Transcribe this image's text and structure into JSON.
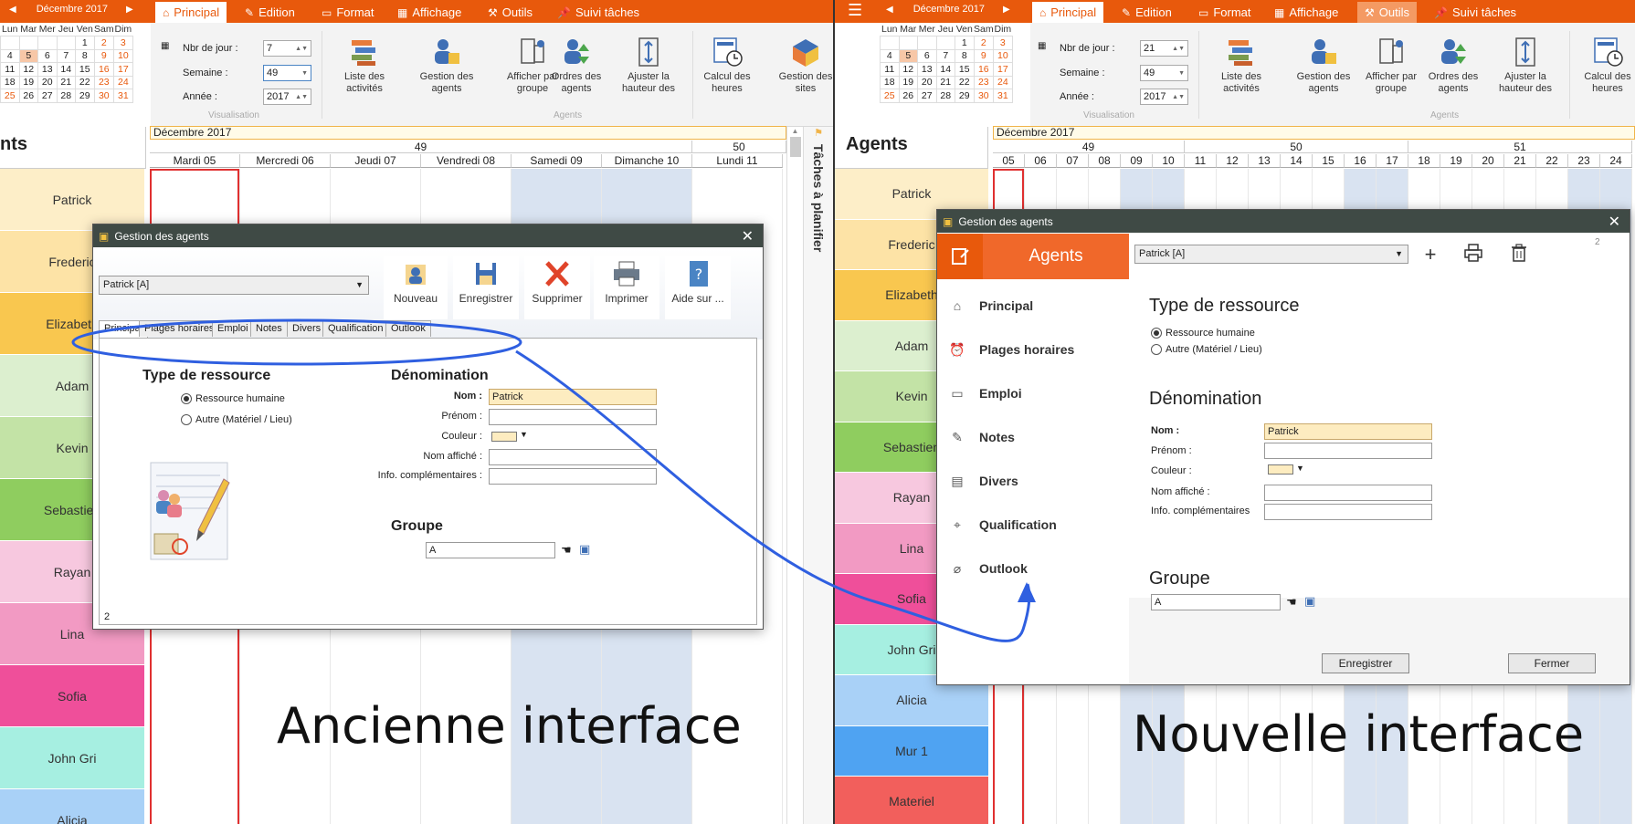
{
  "left": {
    "month_nav": "Décembre 2017",
    "tabs": [
      {
        "label": "Principal",
        "icon": "home-icon"
      },
      {
        "label": "Edition",
        "icon": "edit-icon"
      },
      {
        "label": "Format",
        "icon": "paint-roller-icon"
      },
      {
        "label": "Affichage",
        "icon": "grid-icon"
      },
      {
        "label": "Outils",
        "icon": "tools-icon"
      },
      {
        "label": "Suivi tâches",
        "icon": "pin-icon"
      }
    ],
    "fields": {
      "nbr_label": "Nbr de jour :",
      "nbr_value": "7",
      "semaine_label": "Semaine :",
      "semaine_value": "49",
      "annee_label": "Année :",
      "annee_value": "2017"
    },
    "ribbon_buttons": [
      {
        "label": "Liste des activités"
      },
      {
        "label": "Gestion des agents"
      },
      {
        "label": "Afficher par groupe"
      },
      {
        "label": "Ordres des agents"
      },
      {
        "label": "Ajuster la hauteur des"
      },
      {
        "label": "Calcul des heures"
      },
      {
        "label": "Gestion des sites"
      }
    ],
    "groups": {
      "visualisation": "Visualisation",
      "agents": "Agents"
    },
    "agents_title": "nts",
    "month_bar": "Décembre 2017",
    "weeks": [
      "49",
      "50"
    ],
    "days": [
      "Mardi 05",
      "Mercredi 06",
      "Jeudi 07",
      "Vendredi 08",
      "Samedi 09",
      "Dimanche 10",
      "Lundi 11"
    ],
    "agents": [
      "Patrick",
      "Frederic",
      "Elizabeth",
      "Adam",
      "Kevin",
      "Sebastien",
      "Rayan",
      "Lina",
      "Sofia",
      "John Gri",
      "Alicia"
    ],
    "side_label": "Tâches à planifier",
    "dialog": {
      "title": "Gestion des agents",
      "agent_select": "Patrick  [A]",
      "toolbar": [
        {
          "label": "Nouveau",
          "icon": "new-agent-icon"
        },
        {
          "label": "Enregistrer",
          "icon": "save-icon"
        },
        {
          "label": "Supprimer",
          "icon": "delete-icon"
        },
        {
          "label": "Imprimer",
          "icon": "printer-icon"
        },
        {
          "label": "Aide sur ...",
          "icon": "help-icon"
        }
      ],
      "tabs": [
        "Principal",
        "Plages horaires",
        "Emploi",
        "Notes",
        "Divers",
        "Qualification",
        "Outlook"
      ],
      "type_title": "Type de ressource",
      "radio_human": "Ressource humaine",
      "radio_other": "Autre (Matériel / Lieu)",
      "denom_title": "Dénomination",
      "nom_label": "Nom :",
      "nom_value": "Patrick",
      "prenom_label": "Prénom :",
      "couleur_label": "Couleur :",
      "affiche_label": "Nom affiché :",
      "info_label": "Info. complémentaires :",
      "groupe_title": "Groupe",
      "groupe_value": "A",
      "footer_num": "2"
    },
    "caption": "Ancienne interface"
  },
  "right": {
    "month_nav": "Décembre 2017",
    "tabs": [
      {
        "label": "Principal",
        "icon": "home-icon"
      },
      {
        "label": "Edition",
        "icon": "edit-icon"
      },
      {
        "label": "Format",
        "icon": "paint-roller-icon"
      },
      {
        "label": "Affichage",
        "icon": "grid-icon"
      },
      {
        "label": "Outils",
        "icon": "tools-icon"
      },
      {
        "label": "Suivi tâches",
        "icon": "pin-icon"
      }
    ],
    "fields": {
      "nbr_label": "Nbr de jour :",
      "nbr_value": "21",
      "semaine_label": "Semaine :",
      "semaine_value": "49",
      "annee_label": "Année :",
      "annee_value": "2017"
    },
    "ribbon_buttons": [
      {
        "label": "Liste des activités"
      },
      {
        "label": "Gestion des agents"
      },
      {
        "label": "Afficher par groupe"
      },
      {
        "label": "Ordres des agents"
      },
      {
        "label": "Ajuster la hauteur des"
      },
      {
        "label": "Calcul des heures"
      }
    ],
    "groups": {
      "visualisation": "Visualisation",
      "agents": "Agents"
    },
    "agents_title": "Agents",
    "month_bar": "Décembre 2017",
    "weeks": [
      "49",
      "50",
      "51"
    ],
    "days": [
      "05",
      "06",
      "07",
      "08",
      "09",
      "10",
      "11",
      "12",
      "13",
      "14",
      "15",
      "16",
      "17",
      "18",
      "19",
      "20",
      "21",
      "22",
      "23",
      "24"
    ],
    "agents": [
      "Patrick",
      "Frederic",
      "Elizabeth",
      "Adam",
      "Kevin",
      "Sebastien",
      "Rayan",
      "Lina",
      "Sofia",
      "John Gri",
      "Alicia",
      "Mur 1",
      "Materiel"
    ],
    "dialog": {
      "title": "Gestion des agents",
      "nav_title": "Agents",
      "agent_select": "Patrick  [A]",
      "nav": [
        {
          "label": "Principal",
          "icon": "home-icon"
        },
        {
          "label": "Plages horaires",
          "icon": "alarm-clock-icon"
        },
        {
          "label": "Emploi",
          "icon": "briefcase-icon"
        },
        {
          "label": "Notes",
          "icon": "pencil-icon"
        },
        {
          "label": "Divers",
          "icon": "card-icon"
        },
        {
          "label": "Qualification",
          "icon": "target-icon"
        },
        {
          "label": "Outlook",
          "icon": "paperclip-icon"
        }
      ],
      "type_title": "Type de ressource",
      "radio_human": "Ressource humaine",
      "radio_other": "Autre (Matériel / Lieu)",
      "denom_title": "Dénomination",
      "nom_label": "Nom :",
      "nom_value": "Patrick",
      "prenom_label": "Prénom :",
      "couleur_label": "Couleur :",
      "affiche_label": "Nom affiché :",
      "info_label": "Info. complémentaires",
      "groupe_title": "Groupe",
      "groupe_value": "A",
      "corner_num": "2",
      "btn_save": "Enregistrer",
      "btn_close": "Fermer"
    },
    "caption": "Nouvelle interface"
  },
  "colors": {
    "accent": "#e8590c",
    "annotation_blue": "#2f5fe0",
    "weekend": "#d9e3f1",
    "agents": {
      "Patrick": "#fdeec8",
      "Frederic": "#fde3a6",
      "Elizabeth": "#f9c74f",
      "Adam": "#dcefcf",
      "Kevin": "#c3e3a6",
      "Sebastien": "#8fcd5f",
      "Rayan": "#f7c8df",
      "Lina": "#f29ac3",
      "Sofia": "#ef4f9a",
      "John Gri": "#a6efe1",
      "Alicia": "#a9d1f7",
      "Mur 1": "#4fa3f2",
      "Materiel": "#f25f5c"
    }
  }
}
